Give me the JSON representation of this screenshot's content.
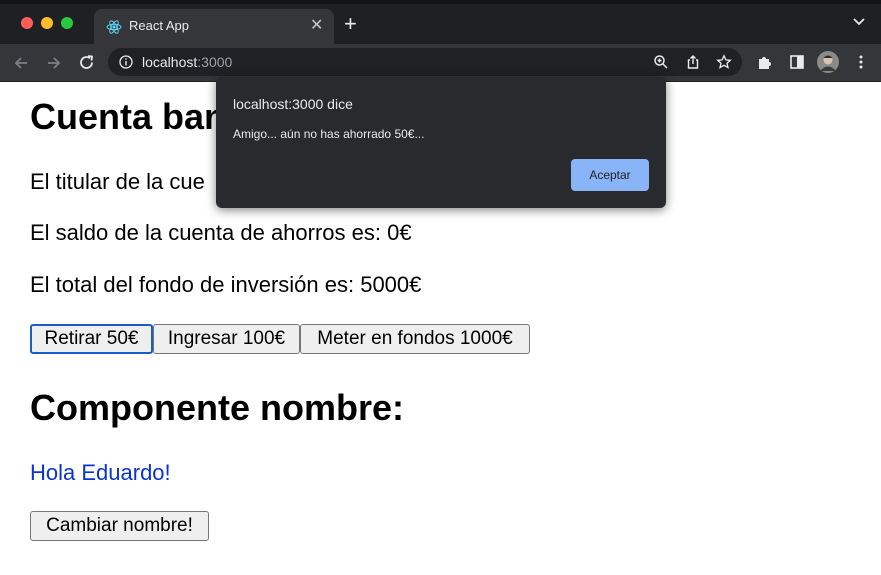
{
  "browser": {
    "tab_title": "React App",
    "tab_close": "✕",
    "new_tab": "+",
    "url_host": "localhost",
    "url_port": ":3000",
    "window_buttons": {
      "close_color": "#ff5f57",
      "minimize_color": "#febc2e",
      "maximize_color": "#28c840"
    }
  },
  "page": {
    "heading_account": "Cuenta ban",
    "holder_text": "El titular de la cue",
    "savings_text": "El saldo de la cuenta de ahorros es: 0€",
    "investment_text": "El total del fondo de inversión es: 5000€",
    "buttons": {
      "withdraw": "Retirar 50€",
      "deposit": "Ingresar 100€",
      "invest": "Meter en fondos 1000€"
    },
    "heading_name": "Componente nombre:",
    "greeting": "Hola Eduardo!",
    "change_name": "Cambiar nombre!"
  },
  "dialog": {
    "title": "localhost:3000 dice",
    "message": "Amigo... aún no has ahorrado 50€...",
    "accept": "Aceptar"
  }
}
